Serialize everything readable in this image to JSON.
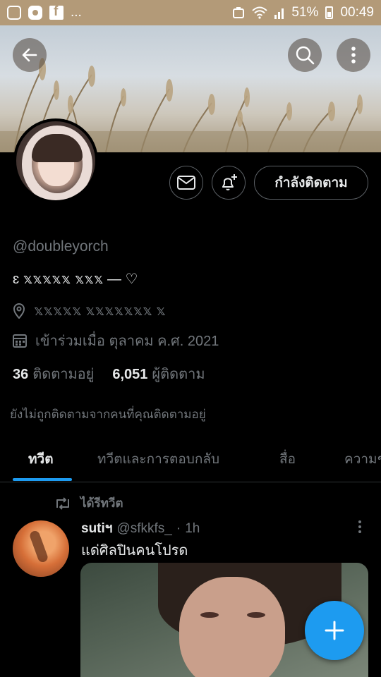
{
  "status_bar": {
    "left_icons": [
      "instagram-icon",
      "notification-icon",
      "facebook-icon"
    ],
    "overflow": "...",
    "battery": "51%",
    "time": "00:49"
  },
  "header": {
    "back_icon": "arrow-left-icon",
    "search_icon": "search-icon",
    "more_icon": "more-vertical-icon"
  },
  "profile": {
    "follow_button": "กำลังติดตาม",
    "handle": "@doubleyorch",
    "bio": "ɛ 𝕩𝕩𝕩𝕩𝕩 𝕩𝕩𝕩 — ♡",
    "location": "𝕩𝕩𝕩𝕩𝕩 𝕩𝕩𝕩𝕩𝕩𝕩𝕩 𝕩",
    "joined": "เข้าร่วมเมื่อ ตุลาคม ค.ศ. 2021",
    "following_count": "36",
    "following_label": "ติดตามอยู่",
    "followers_count": "6,051",
    "followers_label": "ผู้ติดตาม",
    "followed_by_note": "ยังไม่ถูกติดตามจากคนที่คุณติดตามอยู่"
  },
  "tabs": [
    {
      "label": "ทวีต",
      "active": true
    },
    {
      "label": "ทวีตและการตอบกลับ",
      "active": false
    },
    {
      "label": "สื่อ",
      "active": false
    },
    {
      "label": "ความช",
      "active": false
    }
  ],
  "tweet": {
    "retweet_label": "ได้รีทวีต",
    "name": "sutiฯ",
    "username": "@sfkkfs_",
    "dot": "·",
    "time": "1h",
    "text": "แด่ศิลปินคนโปรด"
  },
  "colors": {
    "accent": "#1d9bf0",
    "background": "#000000",
    "muted_text": "#71767b",
    "status_bar": "#b39a78"
  }
}
